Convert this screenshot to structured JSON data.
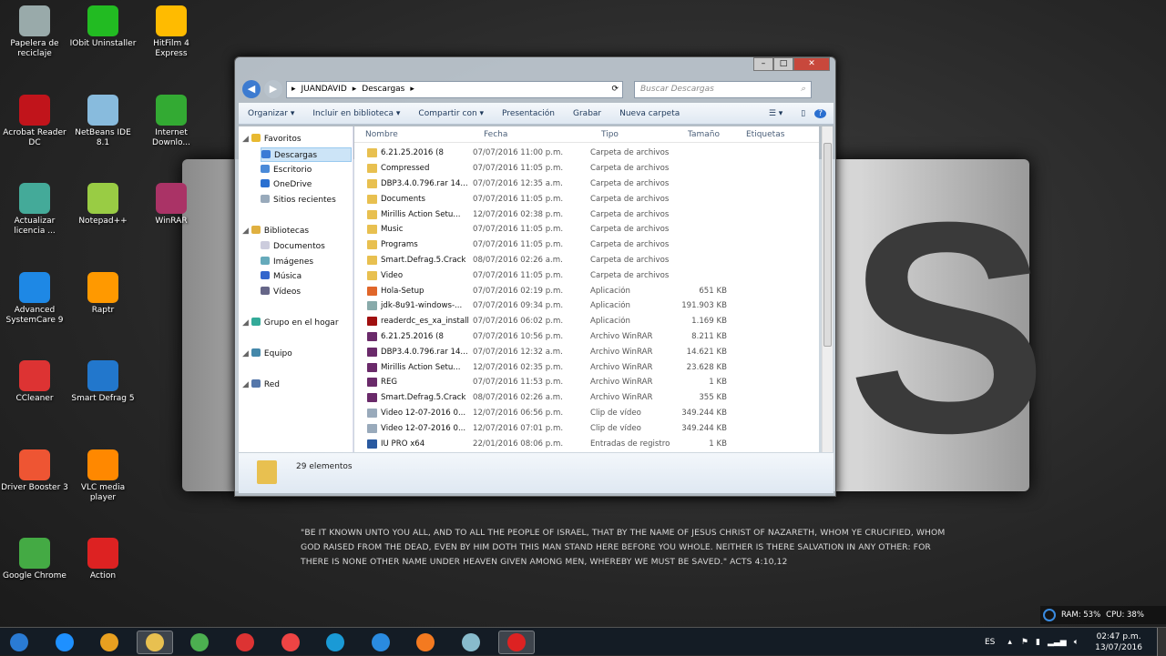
{
  "desktop": {
    "icons": [
      {
        "label": "Papelera de reciclaje",
        "color": "#9aa"
      },
      {
        "label": "Acrobat Reader DC",
        "color": "#c1141b"
      },
      {
        "label": "Actualizar licencia ...",
        "color": "#4a9"
      },
      {
        "label": "Advanced SystemCare 9",
        "color": "#1e88e5"
      },
      {
        "label": "CCleaner",
        "color": "#d33"
      },
      {
        "label": "Driver Booster 3",
        "color": "#e53"
      },
      {
        "label": "Google Chrome",
        "color": "#4a4"
      },
      {
        "label": "IObit Uninstaller",
        "color": "#2b2"
      },
      {
        "label": "NetBeans IDE 8.1",
        "color": "#8bd"
      },
      {
        "label": "Notepad++",
        "color": "#9c4"
      },
      {
        "label": "Raptr",
        "color": "#f90"
      },
      {
        "label": "Smart Defrag 5",
        "color": "#27c"
      },
      {
        "label": "VLC media player",
        "color": "#f80"
      },
      {
        "label": "Action",
        "color": "#d22"
      },
      {
        "label": "HitFilm 4 Express",
        "color": "#fb0"
      },
      {
        "label": "Internet Downlo...",
        "color": "#3a3"
      },
      {
        "label": "WinRAR",
        "color": "#a36"
      }
    ],
    "quote": "\"BE IT KNOWN UNTO YOU ALL, AND TO ALL THE PEOPLE OF ISRAEL, THAT BY THE NAME OF JESUS CHRIST OF NAZARETH, WHOM YE CRUCIFIED, WHOM GOD RAISED FROM THE DEAD, EVEN BY HIM DOTH THIS MAN STAND HERE BEFORE YOU WHOLE. NEITHER IS THERE SALVATION IN ANY OTHER: FOR THERE IS NONE OTHER NAME UNDER HEAVEN GIVEN AMONG MEN, WHEREBY WE MUST BE SAVED.\" ACTS 4:10,12",
    "wallpaper_letter": "S"
  },
  "explorer": {
    "path": [
      "JUANDAVID",
      "Descargas"
    ],
    "search_placeholder": "Buscar Descargas",
    "toolbar": [
      "Organizar ▾",
      "Incluir en biblioteca ▾",
      "Compartir con ▾",
      "Presentación",
      "Grabar",
      "Nueva carpeta"
    ],
    "nav": [
      {
        "label": "Favoritos",
        "level": 0,
        "color": "#e8b931"
      },
      {
        "label": "Descargas",
        "level": 1,
        "color": "#3a7bd5",
        "selected": true
      },
      {
        "label": "Escritorio",
        "level": 1,
        "color": "#4a8ad8"
      },
      {
        "label": "OneDrive",
        "level": 1,
        "color": "#2a6fd0"
      },
      {
        "label": "Sitios recientes",
        "level": 1,
        "color": "#9ab"
      },
      {
        "label": "Bibliotecas",
        "level": 0,
        "color": "#e0b040",
        "gap": true
      },
      {
        "label": "Documentos",
        "level": 1,
        "color": "#ccd"
      },
      {
        "label": "Imágenes",
        "level": 1,
        "color": "#6ab"
      },
      {
        "label": "Música",
        "level": 1,
        "color": "#36c"
      },
      {
        "label": "Vídeos",
        "level": 1,
        "color": "#668"
      },
      {
        "label": "Grupo en el hogar",
        "level": 0,
        "color": "#3a9",
        "gap": true
      },
      {
        "label": "Equipo",
        "level": 0,
        "color": "#48a",
        "gap": true
      },
      {
        "label": "Red",
        "level": 0,
        "color": "#57a",
        "gap": true
      }
    ],
    "columns": [
      "Nombre",
      "Fecha",
      "Tipo",
      "Tamaño",
      "Etiquetas"
    ],
    "files": [
      [
        "6.21.25.2016 (8",
        "07/07/2016 11:00 p.m.",
        "Carpeta de archivos",
        "",
        "folder"
      ],
      [
        "Compressed",
        "07/07/2016 11:05 p.m.",
        "Carpeta de archivos",
        "",
        "folder"
      ],
      [
        "DBP3.4.0.796.rar  14...",
        "07/07/2016 12:35 a.m.",
        "Carpeta de archivos",
        "",
        "folder"
      ],
      [
        "Documents",
        "07/07/2016 11:05 p.m.",
        "Carpeta de archivos",
        "",
        "folder"
      ],
      [
        "Mirillis Action Setu...",
        "12/07/2016 02:38 p.m.",
        "Carpeta de archivos",
        "",
        "folder"
      ],
      [
        "Music",
        "07/07/2016 11:05 p.m.",
        "Carpeta de archivos",
        "",
        "folder"
      ],
      [
        "Programs",
        "07/07/2016 11:05 p.m.",
        "Carpeta de archivos",
        "",
        "folder"
      ],
      [
        "Smart.Defrag.5.Crack",
        "08/07/2016 02:26 a.m.",
        "Carpeta de archivos",
        "",
        "folder"
      ],
      [
        "Video",
        "07/07/2016 11:05 p.m.",
        "Carpeta de archivos",
        "",
        "folder"
      ],
      [
        "Hola-Setup",
        "07/07/2016 02:19 p.m.",
        "Aplicación",
        "651 KB",
        "app"
      ],
      [
        "jdk-8u91-windows-...",
        "07/07/2016 09:34 p.m.",
        "Aplicación",
        "191.903 KB",
        "java"
      ],
      [
        "readerdc_es_xa_install",
        "07/07/2016 06:02 p.m.",
        "Aplicación",
        "1.169 KB",
        "pdf"
      ],
      [
        "6.21.25.2016 (8",
        "07/07/2016 10:56 p.m.",
        "Archivo WinRAR",
        "8.211 KB",
        "rar"
      ],
      [
        "DBP3.4.0.796.rar  14...",
        "07/07/2016 12:32 a.m.",
        "Archivo WinRAR",
        "14.621 KB",
        "rar"
      ],
      [
        "Mirillis Action Setu...",
        "12/07/2016 02:35 p.m.",
        "Archivo WinRAR",
        "23.628 KB",
        "rar"
      ],
      [
        "REG",
        "07/07/2016 11:53 p.m.",
        "Archivo WinRAR",
        "1 KB",
        "rar"
      ],
      [
        "Smart.Defrag.5.Crack",
        "08/07/2016 02:26 a.m.",
        "Archivo WinRAR",
        "355 KB",
        "rar"
      ],
      [
        "Video 12-07-2016 0...",
        "12/07/2016 06:56 p.m.",
        "Clip de vídeo",
        "349.244 KB",
        "video"
      ],
      [
        "Video 12-07-2016 0...",
        "12/07/2016 07:01 p.m.",
        "Clip de vídeo",
        "349.244 KB",
        "video"
      ],
      [
        "IU PRO x64",
        "22/01/2016 08:06 p.m.",
        "Entradas de registro",
        "1 KB",
        "reg"
      ]
    ],
    "status": "29 elementos"
  },
  "gadget": {
    "ram": "RAM: 53%",
    "cpu": "CPU: 38%"
  },
  "tray": {
    "lang": "ES",
    "time": "02:47 p.m.",
    "date": "13/07/2016"
  },
  "taskbar": [
    {
      "name": "start",
      "color": "#2a7bd4"
    },
    {
      "name": "internet-explorer",
      "color": "#1e90ff"
    },
    {
      "name": "media",
      "color": "#e8a020"
    },
    {
      "name": "file-explorer",
      "color": "#e8c050",
      "active": true
    },
    {
      "name": "chrome",
      "color": "#4caf50"
    },
    {
      "name": "driver-booster",
      "color": "#d33"
    },
    {
      "name": "ccleaner",
      "color": "#e44"
    },
    {
      "name": "ie-blue",
      "color": "#1a9ad6"
    },
    {
      "name": "advanced-systemcare",
      "color": "#2a8be0"
    },
    {
      "name": "xampp",
      "color": "#f47a20"
    },
    {
      "name": "netbeans",
      "color": "#8bc"
    },
    {
      "name": "action",
      "color": "#d22",
      "active": true
    }
  ]
}
